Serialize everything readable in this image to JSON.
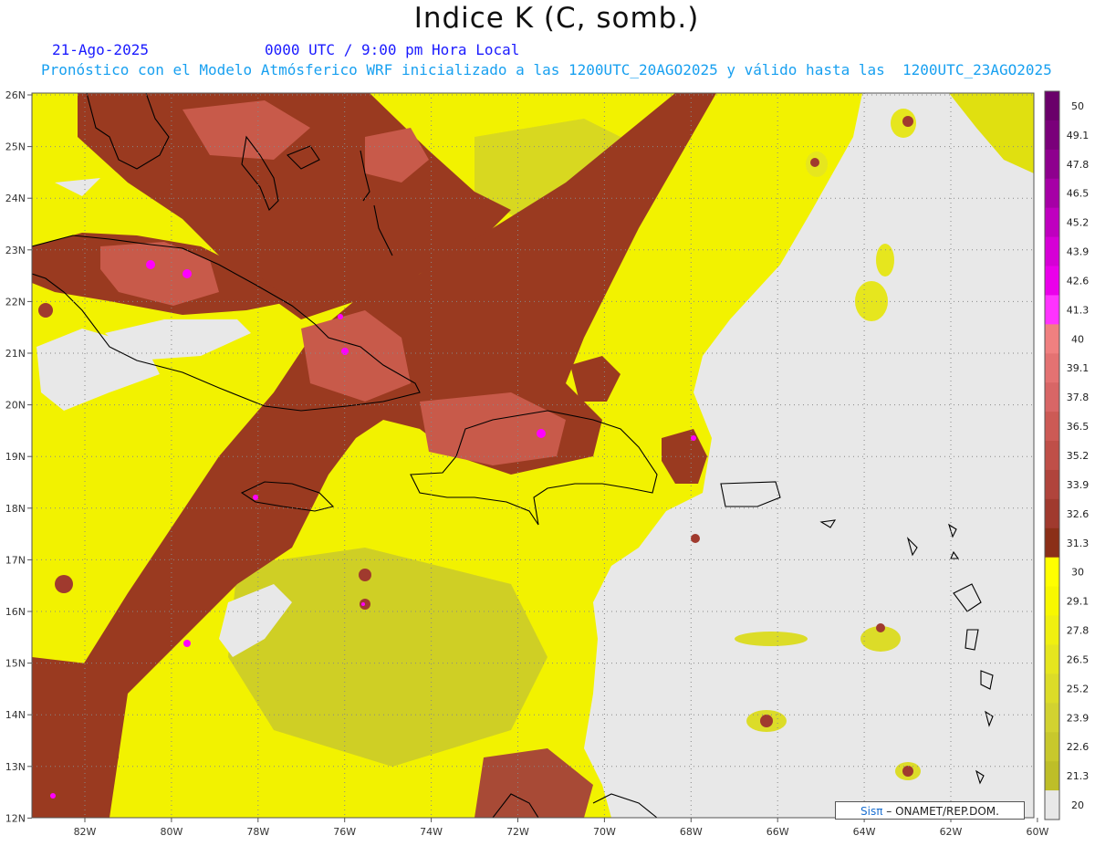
{
  "title": "Indice K (C, somb.)",
  "date": "21-Ago-2025",
  "valid_time": "0000 UTC / 9:00 pm Hora Local",
  "subtitle": "Pronóstico con el Modelo Atmósferico WRF inicializado a las 1200UTC_20AGO2025 y válido hasta las  1200UTC_23AGO2025",
  "credit": {
    "logo": "Sisπ",
    "text": "– ONAMET/REP.DOM."
  },
  "axes": {
    "lon_labels": [
      "82W",
      "80W",
      "78W",
      "76W",
      "74W",
      "72W",
      "70W",
      "68W",
      "66W",
      "64W",
      "62W",
      "60W"
    ],
    "lat_labels": [
      "26N",
      "25N",
      "24N",
      "23N",
      "22N",
      "21N",
      "20N",
      "19N",
      "18N",
      "17N",
      "16N",
      "15N",
      "14N",
      "13N",
      "12N"
    ],
    "grid": "dotted"
  },
  "colorbar": {
    "labels": [
      "50",
      "49.1",
      "47.8",
      "46.5",
      "45.2",
      "43.9",
      "42.6",
      "41.3",
      "40",
      "39.1",
      "37.8",
      "36.5",
      "35.2",
      "33.9",
      "32.6",
      "31.3",
      "30",
      "29.1",
      "27.8",
      "26.5",
      "25.2",
      "23.9",
      "22.6",
      "21.3",
      "20"
    ],
    "colors": [
      "#6a006a",
      "#7a007a",
      "#8e008e",
      "#a600a6",
      "#bf00bf",
      "#d600d6",
      "#ea00ea",
      "#ff33ff",
      "#f08080",
      "#e47272",
      "#d86666",
      "#cc5a55",
      "#bf4f48",
      "#b0443c",
      "#a03a2e",
      "#8b2f18",
      "#ffff00",
      "#f8f800",
      "#f0f010",
      "#e6e61e",
      "#dcdc28",
      "#d2d230",
      "#c8c82c",
      "#bebe28",
      "#e8e8e8"
    ]
  },
  "palette": {
    "background": "#e8e8e8",
    "yellow": "#f2f200",
    "yellow_light": "#ffff20",
    "olive": "#cfcf25",
    "brown": "#9a3a20",
    "salmon": "#c85a4a",
    "pink": "#d86a62",
    "magenta": "#ff00ff",
    "coast": "#000000"
  }
}
